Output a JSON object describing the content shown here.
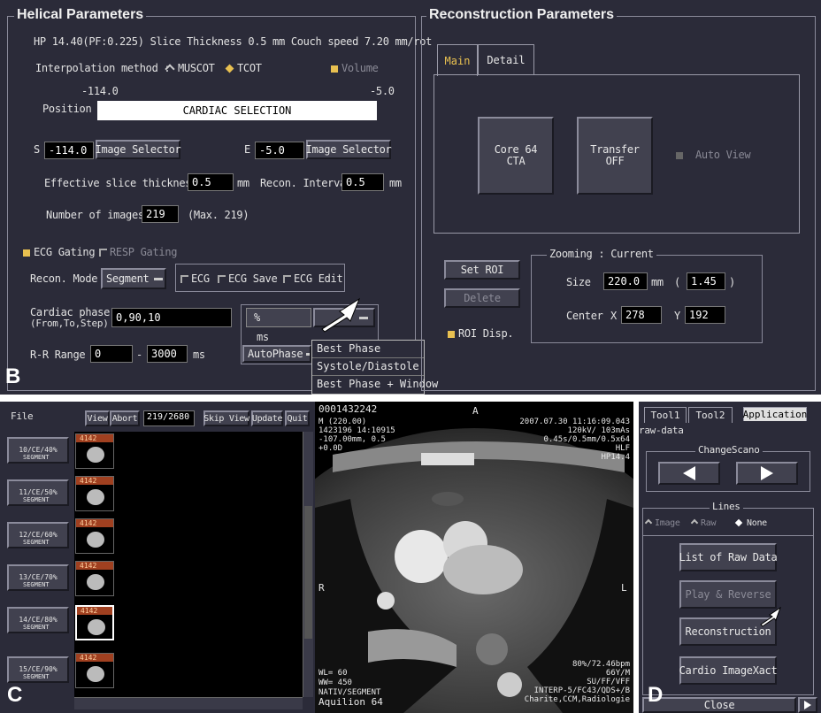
{
  "panel_b": {
    "letter": "B",
    "helical": {
      "title": "Helical Parameters",
      "summary": "HP 14.40(PF:0.225) Slice Thickness 0.5 mm Couch speed 7.20 mm/rot",
      "interp_label": "Interpolation method :",
      "interp_opt1": "MUSCOT",
      "interp_opt2": "TCOT",
      "volume": "Volume",
      "pos_min": "-114.0",
      "pos_max": "-5.0",
      "position_label": "Position",
      "position_value": "CARDIAC SELECTION",
      "s_label": "S",
      "s_value": "-114.0",
      "e_label": "E",
      "e_value": "-5.0",
      "image_selector": "Image Selector",
      "eff_label": "Effective slice thickness",
      "eff_value": "0.5",
      "mm": "mm",
      "interval_label": "Recon. Interval",
      "interval_value": "0.5",
      "num_label": "Number of images",
      "num_value": "219",
      "num_max": "(Max. 219)",
      "ecg_gating": "ECG Gating",
      "resp_gating": "RESP Gating",
      "recon_mode_label": "Recon. Mode",
      "recon_mode_value": "Segment",
      "cb_ecg": "ECG",
      "cb_ecg_save": "ECG Save",
      "cb_ecg_edit": "ECG Edit",
      "phase_label1": "Cardiac phase",
      "phase_label2": "(From,To,Step)",
      "phase_value": "0,90,10",
      "unit_pct": "%",
      "unit_ms": "ms",
      "autophase": "AutoPhase",
      "rr_label": "R-R Range",
      "rr_from": "0",
      "rr_dash": "-",
      "rr_to": "3000",
      "ms": "ms",
      "menu": [
        "Best Phase",
        "Systole/Diastole",
        "Best Phase + Window"
      ]
    },
    "recon": {
      "title": "Reconstruction Parameters",
      "tab_main": "Main",
      "tab_detail": "Detail",
      "core_l1": "Core 64",
      "core_l2": "CTA",
      "transfer_l1": "Transfer",
      "transfer_l2": "OFF",
      "auto_view": "Auto View",
      "set_roi": "Set ROI",
      "delete": "Delete",
      "roi_disp": "ROI Disp.",
      "zoom_title": "Zooming : Current",
      "size_label": "Size",
      "size_value": "220.0",
      "size_mm": "mm",
      "paren_open": "(",
      "zoom_value": "1.45",
      "paren_close": ")",
      "center_label": "Center",
      "x_label": "X",
      "x_value": "278",
      "y_label": "Y",
      "y_value": "192"
    }
  },
  "panel_c": {
    "letter": "C",
    "menu_file": "File",
    "view": "View",
    "abort": "Abort",
    "count": "219/2680",
    "skip_view": "Skip View",
    "update": "Update",
    "quit": "Quit",
    "thumb_header": "4142",
    "series": [
      {
        "l1": "10/CE/40%",
        "l2": "SEGMENT"
      },
      {
        "l1": "11/CE/50%",
        "l2": "SEGMENT"
      },
      {
        "l1": "12/CE/60%",
        "l2": "SEGMENT"
      },
      {
        "l1": "13/CE/70%",
        "l2": "SEGMENT"
      },
      {
        "l1": "14/CE/80%",
        "l2": "SEGMENT"
      },
      {
        "l1": "15/CE/90%",
        "l2": "SEGMENT"
      }
    ],
    "ct": {
      "patient_id": "0001432242",
      "orient_a": "A",
      "orient_r": "R",
      "orient_l": "L",
      "tl2": "M (220.00)",
      "tl3": "1423196 14:10915",
      "tl4": "-107.00mm, 0.5",
      "tl5": "+0.0D",
      "tr1": "2007.07.30 11:16:09.043",
      "tr2": "120kV/ 103mAs",
      "tr3": "0.45s/0.5mm/0.5x64",
      "tr4": "HLF",
      "tr5": "HP14.4",
      "bl1": "WL= 60",
      "bl2": "WW= 450",
      "bl3": "NATIV/SEGMENT",
      "bl4": "Aquilion 64",
      "br1": "80%/72.46bpm",
      "br2": "66Y/M",
      "br3": "SU/FF/VFF",
      "br4": "INTERP-5/FC43/QDS+/B",
      "br5": "Charite,CCM,Radiologie"
    }
  },
  "panel_d": {
    "letter": "D",
    "tab_tool1": "Tool1",
    "tab_tool2": "Tool2",
    "tab_app": "Application",
    "raw_data": "raw-data",
    "change_scano": "ChangeScano",
    "lines": "Lines",
    "opt_image": "Image",
    "opt_raw": "Raw",
    "opt_none": "None",
    "list_raw": "List of Raw Data",
    "play_reverse": "Play & Reverse",
    "reconstruction": "Reconstruction",
    "cardio": "Cardio ImageXact",
    "close": "Close"
  }
}
